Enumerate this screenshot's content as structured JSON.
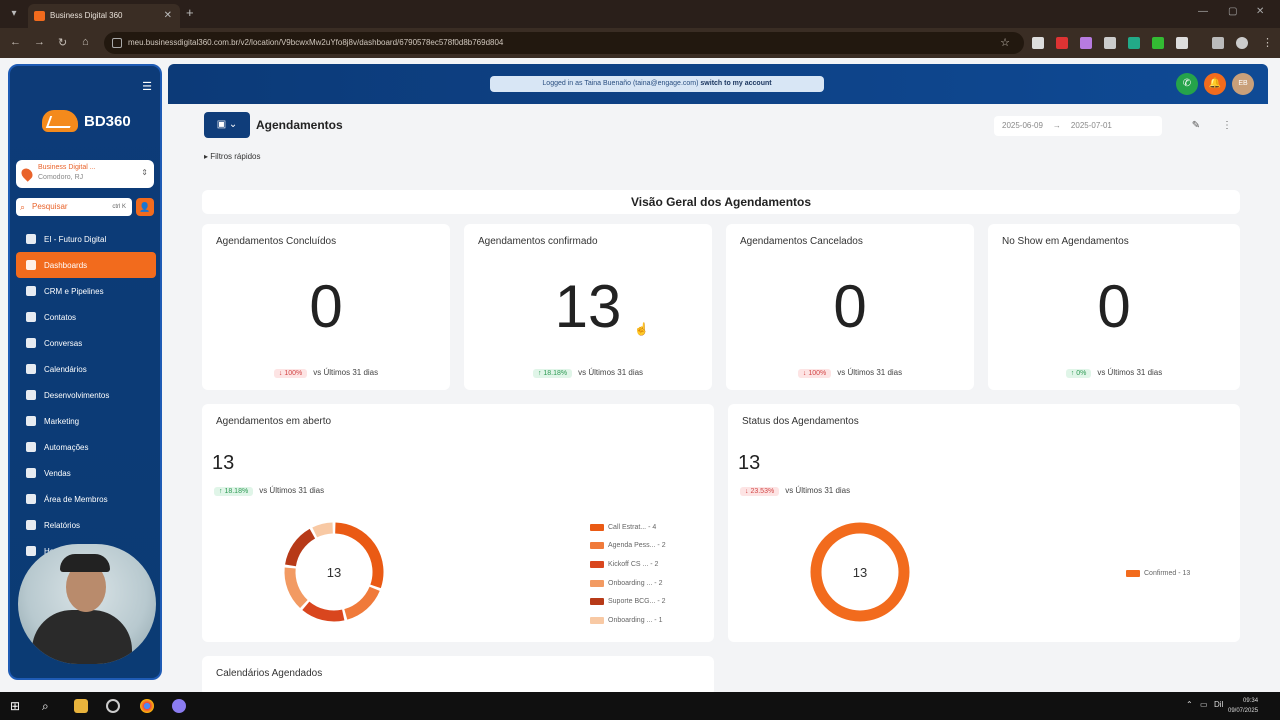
{
  "browser": {
    "tab_title": "Business Digital 360",
    "url": "meu.businessdigital360.com.br/v2/location/V9bcwxMw2uYfo8j8v/dashboard/6790578ec578f0d8b769d804"
  },
  "sidebar": {
    "logo_text": "BD360",
    "account_name": "Business Digital ...",
    "account_sub": "Comodoro, RJ",
    "search_placeholder": "Pesquisar",
    "search_shortcut": "ctrl K",
    "items": [
      {
        "label": "EI - Futuro Digital",
        "icon": "grid-icon"
      },
      {
        "label": "Dashboards",
        "icon": "dashboard-icon",
        "active": true
      },
      {
        "label": "CRM e Pipelines",
        "icon": "crm-icon"
      },
      {
        "label": "Contatos",
        "icon": "contacts-icon"
      },
      {
        "label": "Conversas",
        "icon": "chat-icon"
      },
      {
        "label": "Calendários",
        "icon": "calendar-icon"
      },
      {
        "label": "Desenvolvimentos",
        "icon": "monitor-icon"
      },
      {
        "label": "Marketing",
        "icon": "megaphone-icon"
      },
      {
        "label": "Automações",
        "icon": "automation-icon"
      },
      {
        "label": "Vendas",
        "icon": "cart-icon"
      },
      {
        "label": "Área de Membros",
        "icon": "members-icon"
      },
      {
        "label": "Relatórios",
        "icon": "reports-icon"
      },
      {
        "label": "Ho...",
        "icon": "image-icon"
      }
    ]
  },
  "topbar": {
    "impersonate_text": "Logged in as Taina Buenaño (taina@engage.com)",
    "switch_link": "switch to my account",
    "avatar_initials": "EB"
  },
  "header": {
    "title": "Agendamentos",
    "quick_filters": "Filtros rápidos",
    "date_start": "2025-06-09",
    "date_end": "2025-07-01"
  },
  "overview_title": "Visão Geral dos Agendamentos",
  "kpis": [
    {
      "title": "Agendamentos Concluídos",
      "value": "0",
      "badge": "100%",
      "trend": "down",
      "compare": "vs Últimos 31 dias"
    },
    {
      "title": "Agendamentos confirmado",
      "value": "13",
      "badge": "18.18%",
      "trend": "up",
      "compare": "vs Últimos 31 dias"
    },
    {
      "title": "Agendamentos Cancelados",
      "value": "0",
      "badge": "100%",
      "trend": "down",
      "compare": "vs Últimos 31 dias"
    },
    {
      "title": "No Show em Agendamentos",
      "value": "0",
      "badge": "0%",
      "trend": "up",
      "compare": "vs Últimos 31 dias"
    }
  ],
  "open_appointments": {
    "title": "Agendamentos em aberto",
    "value": "13",
    "badge": "18.18%",
    "trend": "up",
    "compare": "vs Últimos 31 dias",
    "center_label": "13",
    "legend": [
      {
        "label": "Call Estrat... - 4",
        "value": 4,
        "color": "#ea5a14"
      },
      {
        "label": "Agenda Pess... - 2",
        "value": 2,
        "color": "#f07a3a"
      },
      {
        "label": "Kickoff CS ... - 2",
        "value": 2,
        "color": "#d9461e"
      },
      {
        "label": "Onboarding ... - 2",
        "value": 2,
        "color": "#f29a62"
      },
      {
        "label": "Suporte BCG... - 2",
        "value": 2,
        "color": "#b73a18"
      },
      {
        "label": "Onboarding ... - 1",
        "value": 1,
        "color": "#f8c9a4"
      }
    ]
  },
  "status": {
    "title": "Status dos Agendamentos",
    "value": "13",
    "badge": "23.53%",
    "trend": "down",
    "compare": "vs Últimos 31 dias",
    "center_label": "13",
    "legend": [
      {
        "label": "Confirmed - 13",
        "value": 13,
        "color": "#f26b1d"
      }
    ]
  },
  "calendars_title": "Calendários Agendados",
  "taskbar": {
    "lang": "Dil",
    "time": "09:34",
    "date": "09/07/2025"
  }
}
